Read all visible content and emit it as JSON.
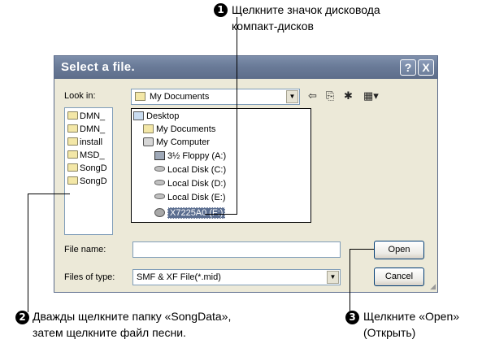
{
  "callouts": {
    "c1": {
      "num": "1",
      "line1": "Щелкните значок дисковода",
      "line2": "компакт-дисков"
    },
    "c2": {
      "num": "2",
      "line1": "Дважды щелкните папку «SongData»,",
      "line2": "затем щелкните файл песни."
    },
    "c3": {
      "num": "3",
      "line1": "Щелкните «Open»",
      "line2": "(Открыть)"
    }
  },
  "dialog": {
    "title": "Select a file.",
    "help_btn": "?",
    "close_btn": "X",
    "look_in_label": "Look in:",
    "look_in_value": "My Documents",
    "toolbar_icons": [
      "back-icon",
      "up-folder-icon",
      "new-folder-icon",
      "view-menu-icon"
    ],
    "files": [
      "DMN_",
      "DMN_",
      "install",
      "MSD_",
      "SongD",
      "SongD"
    ],
    "dropdown_items": [
      {
        "label": "Desktop",
        "icon": "desktop-icon"
      },
      {
        "label": "My Documents",
        "icon": "documents-icon"
      },
      {
        "label": "My Computer",
        "icon": "computer-icon"
      },
      {
        "label": "3½ Floppy (A:)",
        "icon": "floppy-icon"
      },
      {
        "label": "Local Disk (C:)",
        "icon": "disk-icon"
      },
      {
        "label": "Local Disk (D:)",
        "icon": "disk-icon"
      },
      {
        "label": "Local Disk (E:)",
        "icon": "disk-icon"
      },
      {
        "label": "X7225A0 (F:)",
        "icon": "cd-drive-icon",
        "selected": true
      }
    ],
    "file_name_label": "File name:",
    "file_name_value": "",
    "files_of_type_label": "Files of type:",
    "files_of_type_value": "SMF & XF File(*.mid)",
    "open_button": "Open",
    "cancel_button": "Cancel"
  }
}
